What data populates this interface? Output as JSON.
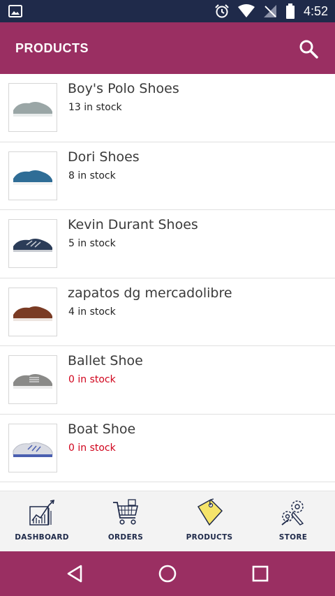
{
  "status_bar": {
    "time": "4:52",
    "icons": [
      "image-icon",
      "alarm-icon",
      "wifi-icon",
      "no-signal-icon",
      "battery-icon"
    ]
  },
  "app_bar": {
    "title": "PRODUCTS",
    "search_icon": "search-icon"
  },
  "products": [
    {
      "name": "Boy's Polo Shoes",
      "stock": "13 in stock",
      "in_stock": true,
      "shoe_color": "#9aa6a6"
    },
    {
      "name": "Dori Shoes",
      "stock": "8 in stock",
      "in_stock": true,
      "shoe_color": "#2f6d96"
    },
    {
      "name": "Kevin Durant Shoes",
      "stock": "5 in stock",
      "in_stock": true,
      "shoe_color": "#2b3c58"
    },
    {
      "name": "zapatos dg mercadolibre",
      "stock": "4 in stock",
      "in_stock": true,
      "shoe_color": "#7a3b24"
    },
    {
      "name": "Ballet Shoe",
      "stock": "0 in stock",
      "in_stock": false,
      "shoe_color": "#8a8a88"
    },
    {
      "name": "Boat Shoe",
      "stock": "0 in stock",
      "in_stock": false,
      "shoe_color": "#d9dbe3"
    }
  ],
  "bottom_nav": [
    {
      "label": "DASHBOARD",
      "icon": "dashboard-icon",
      "active": false
    },
    {
      "label": "ORDERS",
      "icon": "cart-icon",
      "active": false
    },
    {
      "label": "PRODUCTS",
      "icon": "tag-icon",
      "active": true
    },
    {
      "label": "STORE",
      "icon": "tools-icon",
      "active": false
    }
  ],
  "colors": {
    "primary": "#9a2f62",
    "status_bar": "#1f2a4a",
    "out_of_stock": "#d0021b",
    "nav_icon": "#1f2a4a",
    "active_tag": "#f5e46a"
  }
}
